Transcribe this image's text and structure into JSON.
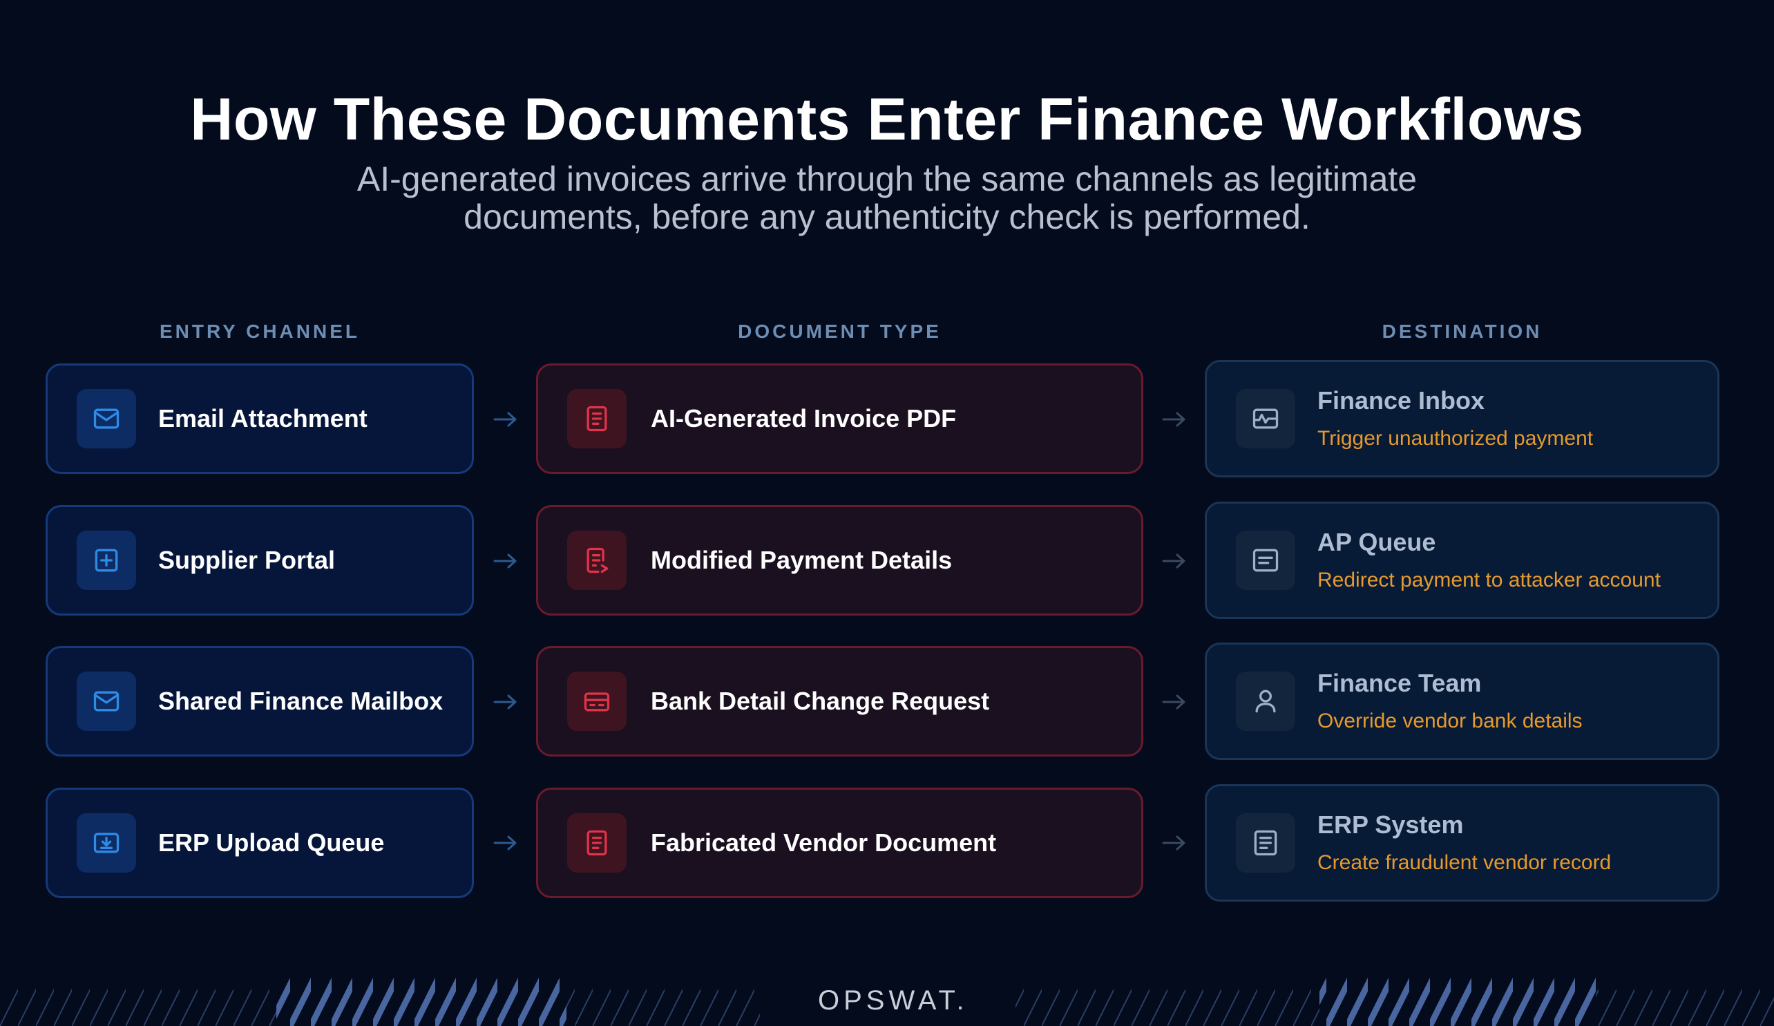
{
  "title": "How These Documents Enter Finance Workflows",
  "subtitle_line1": "AI-generated invoices arrive through the same channels as legitimate",
  "subtitle_line2": "documents, before any authenticity check is performed.",
  "columns": {
    "entry": "ENTRY CHANNEL",
    "doc": "DOCUMENT TYPE",
    "dest": "DESTINATION"
  },
  "rows": [
    {
      "entry": {
        "label": "Email Attachment",
        "icon": "envelope-icon"
      },
      "doc": {
        "label": "AI-Generated Invoice PDF",
        "icon": "document-icon"
      },
      "dest": {
        "title": "Finance Inbox",
        "subtitle": "Trigger unauthorized payment",
        "icon": "inbox-icon"
      }
    },
    {
      "entry": {
        "label": "Supplier Portal",
        "icon": "portal-plus-icon"
      },
      "doc": {
        "label": "Modified Payment Details",
        "icon": "edited-document-icon"
      },
      "dest": {
        "title": "AP Queue",
        "subtitle": "Redirect payment to attacker account",
        "icon": "queue-icon"
      }
    },
    {
      "entry": {
        "label": "Shared Finance Mailbox",
        "icon": "envelope-icon"
      },
      "doc": {
        "label": "Bank Detail Change Request",
        "icon": "credit-card-icon"
      },
      "dest": {
        "title": "Finance Team",
        "subtitle": "Override vendor bank details",
        "icon": "user-icon"
      }
    },
    {
      "entry": {
        "label": "ERP Upload Queue",
        "icon": "upload-tray-icon"
      },
      "doc": {
        "label": "Fabricated Vendor Document",
        "icon": "document-icon"
      },
      "dest": {
        "title": "ERP System",
        "subtitle": "Create fraudulent vendor record",
        "icon": "list-document-icon"
      }
    }
  ],
  "logo": "OPSWAT.",
  "colors": {
    "background": "#030b1d",
    "entry_accent": "#2f8be6",
    "doc_accent": "#e2334a",
    "dest_accent": "#9fb0c6",
    "dest_subtitle": "#e69a2e"
  }
}
